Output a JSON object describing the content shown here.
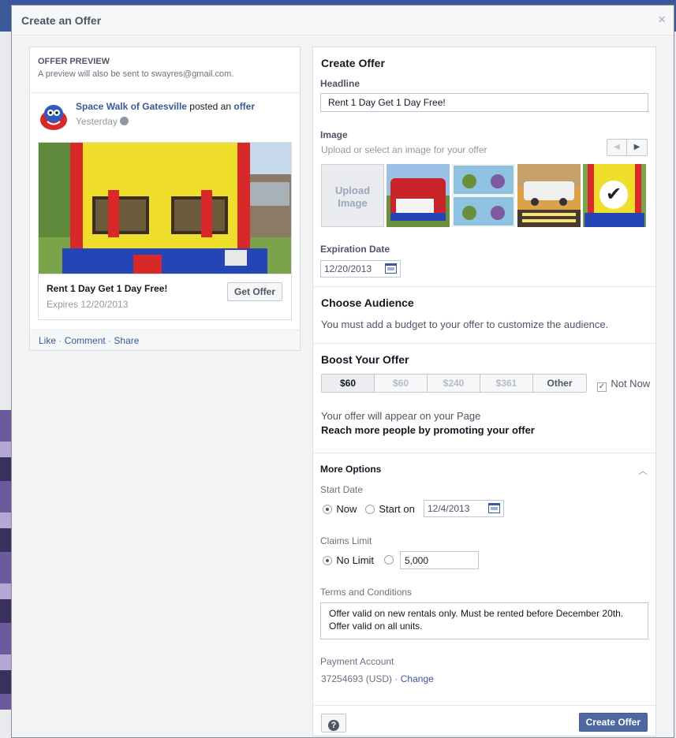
{
  "dialog": {
    "title": "Create an Offer",
    "close_label": "×"
  },
  "preview": {
    "label": "OFFER PREVIEW",
    "subtitle": "A preview will also be sent to swayres@gmail.com.",
    "page_name": "Space Walk of Gatesville",
    "posted_text": "posted an",
    "offer_link": "offer",
    "time": "Yesterday",
    "card_headline": "Rent 1 Day Get 1 Day Free!",
    "card_expires": "Expires 12/20/2013",
    "get_offer_label": "Get Offer",
    "actions": {
      "like": "Like",
      "comment": "Comment",
      "share": "Share",
      "separator": "·"
    }
  },
  "form": {
    "title": "Create Offer",
    "headline_label": "Headline",
    "headline_value": "Rent 1 Day Get 1 Day Free!",
    "image_label": "Image",
    "image_help": "Upload or select an image for your offer",
    "upload_line1": "Upload",
    "upload_line2": "Image",
    "selected_check": "✔",
    "expiration_label": "Expiration Date",
    "expiration_value": "12/20/2013"
  },
  "audience": {
    "title": "Choose Audience",
    "help": "You must add a budget to your offer to customize the audience."
  },
  "boost": {
    "title": "Boost Your Offer",
    "options": [
      "$60",
      "$60",
      "$240",
      "$361",
      "Other"
    ],
    "not_now_label": "Not Now",
    "not_now_checked": "✓",
    "info": "Your offer will appear on your Page",
    "promote": "Reach more people by promoting your offer"
  },
  "more_options": {
    "title": "More Options",
    "start_date_label": "Start Date",
    "now_label": "Now",
    "start_on_label": "Start on",
    "start_on_value": "12/4/2013",
    "claims_limit_label": "Claims Limit",
    "no_limit_label": "No Limit",
    "limit_value": "5,000",
    "terms_label": "Terms and Conditions",
    "terms_line1": "Offer valid on new rentals only. Must be rented before December 20th.",
    "terms_line2": "Offer valid on all units.",
    "payment_label": "Payment Account",
    "payment_value": "37254693 (USD)",
    "payment_sep": "·",
    "change_label": "Change"
  },
  "footer": {
    "help_glyph": "?",
    "create_label": "Create Offer"
  },
  "colors": {
    "brand_blue": "#3b5998",
    "button_blue": "#4e69a2"
  }
}
